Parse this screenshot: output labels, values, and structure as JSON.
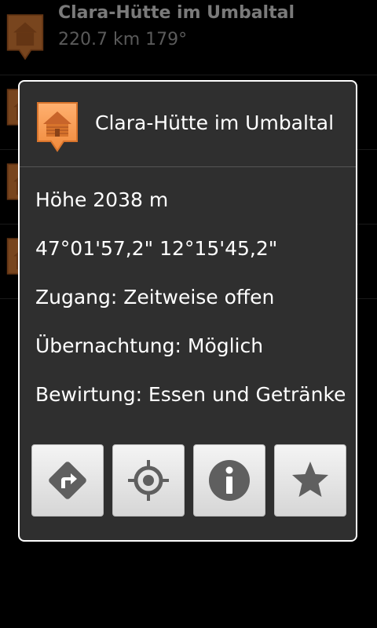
{
  "background_list": {
    "first_item": {
      "title": "Clara-Hütte im Umbaltal",
      "distance": "220.7 km 179°"
    }
  },
  "dialog": {
    "title": "Clara-Hütte im Umbaltal",
    "icon": "hut-marker-icon",
    "lines": [
      "Höhe 2038 m",
      "47°01'57,2\" 12°15'45,2\"",
      "Zugang: Zeitweise offen",
      "Übernachtung: Möglich",
      "Bewirtung: Essen und Getränke"
    ],
    "buttons": [
      {
        "icon": "directions-icon"
      },
      {
        "icon": "locate-icon"
      },
      {
        "icon": "info-icon"
      },
      {
        "icon": "star-icon"
      }
    ]
  },
  "colors": {
    "marker_orange": "#f08a3c",
    "dialog_bg": "#2f2f2f",
    "button_icon_gray": "#5f5f5f"
  }
}
